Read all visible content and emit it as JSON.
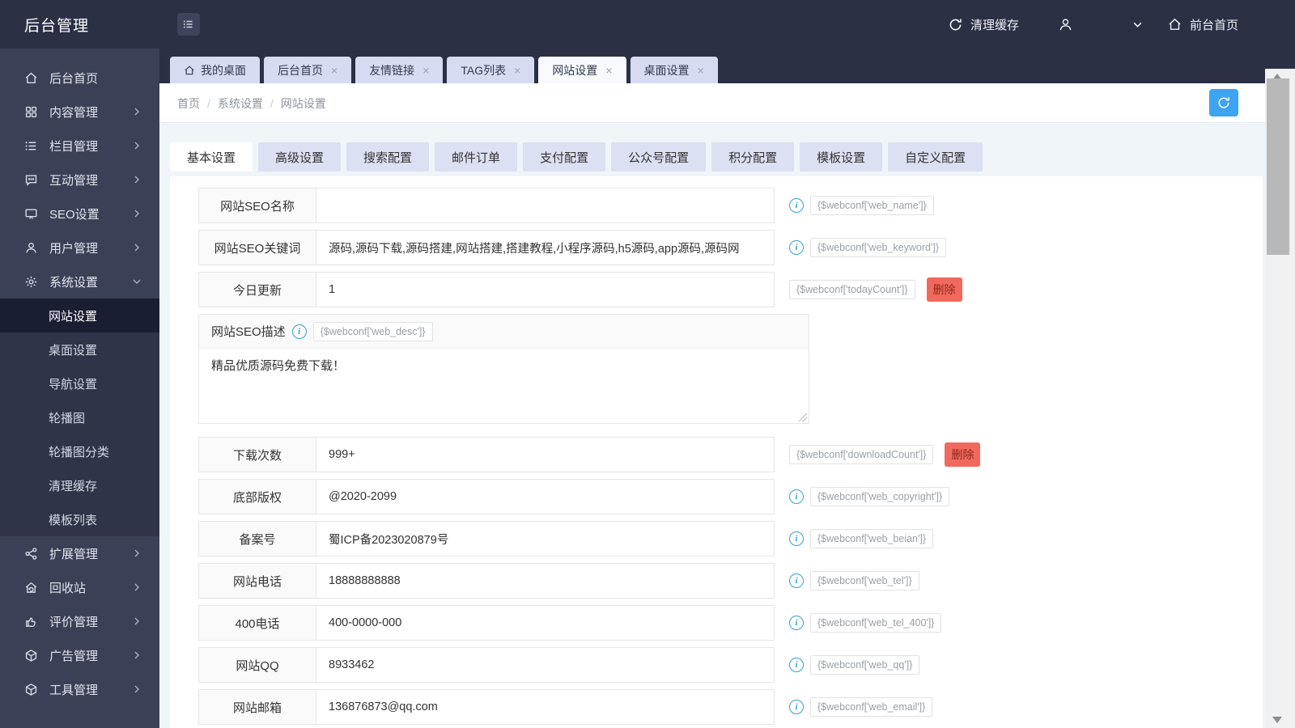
{
  "colors": {
    "accent": "#3ca4f2",
    "danger": "#f0695c",
    "info": "#36a3c9",
    "header_bg": "#2b3045",
    "sidebar_bg": "#3a4157"
  },
  "header": {
    "logo": "后台管理",
    "clear_cache": "清理缓存",
    "username": "",
    "front_home": "前台首页"
  },
  "sidebar": {
    "menu": [
      {
        "label": "后台首页",
        "icon": "home"
      },
      {
        "label": "内容管理",
        "icon": "grid",
        "chevron": "right"
      },
      {
        "label": "栏目管理",
        "icon": "list",
        "chevron": "right"
      },
      {
        "label": "互动管理",
        "icon": "comment",
        "chevron": "right"
      },
      {
        "label": "SEO设置",
        "icon": "monitor",
        "chevron": "right"
      },
      {
        "label": "用户管理",
        "icon": "user",
        "chevron": "right"
      },
      {
        "label": "系统设置",
        "icon": "gear",
        "chevron": "down"
      },
      {
        "submenu": [
          {
            "label": "网站设置",
            "active": true
          },
          {
            "label": "桌面设置"
          },
          {
            "label": "导航设置"
          },
          {
            "label": "轮播图"
          },
          {
            "label": "轮播图分类"
          },
          {
            "label": "清理缓存"
          },
          {
            "label": "模板列表"
          }
        ]
      },
      {
        "label": "扩展管理",
        "icon": "share",
        "chevron": "right"
      },
      {
        "label": "回收站",
        "icon": "recycle",
        "chevron": "right"
      },
      {
        "label": "评价管理",
        "icon": "thumbs",
        "chevron": "right"
      },
      {
        "label": "广告管理",
        "icon": "cube",
        "chevron": "right"
      },
      {
        "label": "工具管理",
        "icon": "box",
        "chevron": "right"
      }
    ]
  },
  "window_tabs": [
    {
      "label": "我的桌面",
      "home": true,
      "closable": false,
      "active": false
    },
    {
      "label": "后台首页",
      "closable": true,
      "active": false
    },
    {
      "label": "友情链接",
      "closable": true,
      "active": false
    },
    {
      "label": "TAG列表",
      "closable": true,
      "active": false
    },
    {
      "label": "网站设置",
      "closable": true,
      "active": true
    },
    {
      "label": "桌面设置",
      "closable": true,
      "active": false
    }
  ],
  "breadcrumb": {
    "items": [
      "首页",
      "系统设置",
      "网站设置"
    ]
  },
  "settings_tabs": {
    "active_index": 0,
    "items": [
      "基本设置",
      "高级设置",
      "搜索配置",
      "邮件订单",
      "支付配置",
      "公众号配置",
      "积分配置",
      "模板设置",
      "自定义配置"
    ]
  },
  "form": {
    "rows": [
      {
        "label": "网站SEO名称",
        "value": "",
        "info": true,
        "tag": "{$webconf['web_name']}"
      },
      {
        "label": "网站SEO关键词",
        "value": "源码,源码下载,源码搭建,网站搭建,搭建教程,小程序源码,h5源码,app源码,源码网",
        "info": true,
        "tag": "{$webconf['web_keyword']}"
      },
      {
        "label": "今日更新",
        "value": "1",
        "info": false,
        "tag": "{$webconf['todayCount']}",
        "delete_label": "删除"
      },
      {
        "type": "textarea",
        "label": "网站SEO描述",
        "value": "精品优质源码免费下载！",
        "info": true,
        "tag": "{$webconf['web_desc']}"
      },
      {
        "label": "下载次数",
        "value": "999+",
        "info": false,
        "tag": "{$webconf['downloadCount']}",
        "delete_label": "删除"
      },
      {
        "label": "底部版权",
        "value": "@2020-2099",
        "info": true,
        "tag": "{$webconf['web_copyright']}"
      },
      {
        "label": "备案号",
        "value": "蜀ICP备2023020879号",
        "info": true,
        "tag": "{$webconf['web_beian']}"
      },
      {
        "label": "网站电话",
        "value": "18888888888",
        "info": true,
        "tag": "{$webconf['web_tel']}"
      },
      {
        "label": "400电话",
        "value": "400-0000-000",
        "info": true,
        "tag": "{$webconf['web_tel_400']}"
      },
      {
        "label": "网站QQ",
        "value": "8933462",
        "info": true,
        "tag": "{$webconf['web_qq']}"
      },
      {
        "label": "网站邮箱",
        "value": "136876873@qq.com",
        "info": true,
        "tag": "{$webconf['web_email']}"
      }
    ]
  }
}
